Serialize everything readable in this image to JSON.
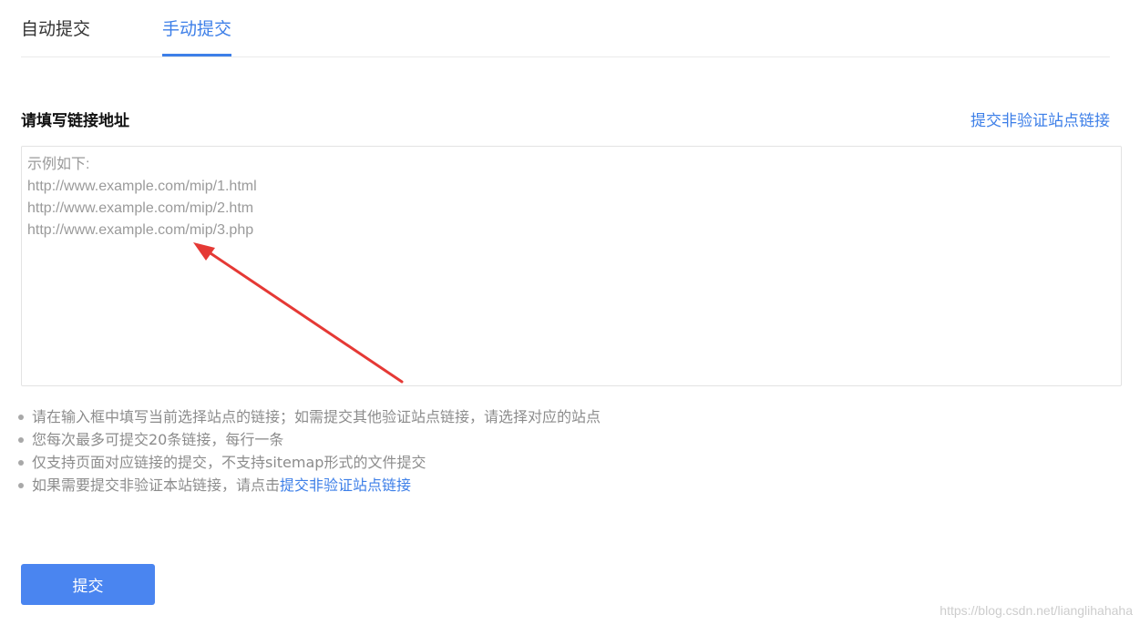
{
  "tabs": {
    "auto_label": "自动提交",
    "manual_label": "手动提交",
    "active": "manual"
  },
  "form": {
    "title": "请填写链接地址",
    "nonverified_link": "提交非验证站点链接",
    "textarea_placeholder": "示例如下:\nhttp://www.example.com/mip/1.html\nhttp://www.example.com/mip/2.htm\nhttp://www.example.com/mip/3.php",
    "textarea_value": ""
  },
  "tips": {
    "item1": "请在输入框中填写当前选择站点的链接；如需提交其他验证站点链接，请选择对应的站点",
    "item2": "您每次最多可提交20条链接，每行一条",
    "item3": "仅支持页面对应链接的提交，不支持sitemap形式的文件提交",
    "item4_prefix": "如果需要提交非验证本站链接，请点击",
    "item4_link": "提交非验证站点链接"
  },
  "submit_label": "提交",
  "watermark": "https://blog.csdn.net/lianglihahaha",
  "colors": {
    "accent": "#3d7fe8",
    "button": "#4a85f0",
    "annotation_arrow": "#e53935"
  },
  "icons": {
    "annotation": "red-arrow-icon",
    "bullet": "bullet-dot-icon"
  }
}
